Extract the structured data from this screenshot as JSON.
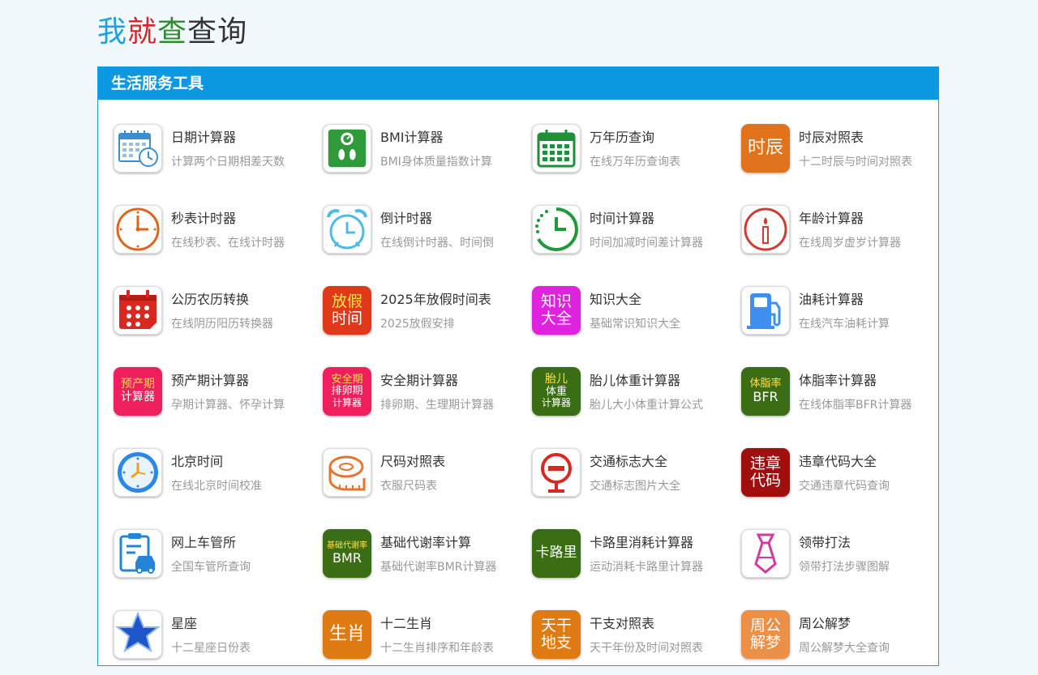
{
  "logo": {
    "c1": "我",
    "c2": "就",
    "c3": "查",
    "c4": "查",
    "c5": "询"
  },
  "panel": {
    "title": "生活服务工具"
  },
  "rows": [
    [
      {
        "title": "日期计算器",
        "sub": "计算两个日期相差天数",
        "icon": "calendar-clock-icon"
      },
      {
        "title": "BMI计算器",
        "sub": "BMI身体质量指数计算",
        "icon": "scale-icon"
      },
      {
        "title": "万年历查询",
        "sub": "在线万年历查询表",
        "icon": "calendar-icon"
      },
      {
        "title": "时辰对照表",
        "sub": "十二时辰与时间对照表",
        "icon": "text-icon",
        "text": [
          "时辰"
        ]
      }
    ],
    [
      {
        "title": "秒表计时器",
        "sub": "在线秒表、在线计时器",
        "icon": "clock-icon"
      },
      {
        "title": "倒计时器",
        "sub": "在线倒计时器、时间倒",
        "icon": "alarm-clock-icon"
      },
      {
        "title": "时间计算器",
        "sub": "时间加减时间差计算器",
        "icon": "time-circle-icon"
      },
      {
        "title": "年龄计算器",
        "sub": "在线周岁虚岁计算器",
        "icon": "candle-icon"
      }
    ],
    [
      {
        "title": "公历农历转换",
        "sub": "在线阴历阳历转换器",
        "icon": "red-calendar-icon"
      },
      {
        "title": "2025年放假时间表",
        "sub": "2025放假安排",
        "icon": "text-icon",
        "text": [
          "放假",
          "时间"
        ]
      },
      {
        "title": "知识大全",
        "sub": "基础常识知识大全",
        "icon": "text-icon",
        "text": [
          "知识",
          "大全"
        ]
      },
      {
        "title": "油耗计算器",
        "sub": "在线汽车油耗计算",
        "icon": "fuel-pump-icon"
      }
    ],
    [
      {
        "title": "预产期计算器",
        "sub": "孕期计算器、怀孕计算",
        "icon": "text-icon",
        "text": [
          "预产期",
          "计算器"
        ]
      },
      {
        "title": "安全期计算器",
        "sub": "排卵期、生理期计算器",
        "icon": "text-icon",
        "text": [
          "安全期",
          "排卵期",
          "计算器"
        ]
      },
      {
        "title": "胎儿体重计算器",
        "sub": "胎儿大小体重计算公式",
        "icon": "text-icon",
        "text": [
          "胎儿",
          "体重",
          "计算器"
        ]
      },
      {
        "title": "体脂率计算器",
        "sub": "在线体脂率BFR计算器",
        "icon": "text-icon",
        "text": [
          "体脂率",
          "BFR"
        ]
      }
    ],
    [
      {
        "title": "北京时间",
        "sub": "在线北京时间校准",
        "icon": "blue-clock-icon"
      },
      {
        "title": "尺码对照表",
        "sub": "衣服尺码表",
        "icon": "tape-measure-icon"
      },
      {
        "title": "交通标志大全",
        "sub": "交通标志图片大全",
        "icon": "traffic-sign-icon"
      },
      {
        "title": "违章代码大全",
        "sub": "交通违章代码查询",
        "icon": "text-icon",
        "text": [
          "违章",
          "代码"
        ]
      }
    ],
    [
      {
        "title": "网上车管所",
        "sub": "全国车管所查询",
        "icon": "car-form-icon"
      },
      {
        "title": "基础代谢率计算",
        "sub": "基础代谢率BMR计算器",
        "icon": "text-icon",
        "text": [
          "基础代谢率",
          "BMR"
        ]
      },
      {
        "title": "卡路里消耗计算器",
        "sub": "运动消耗卡路里计算器",
        "icon": "text-icon",
        "text": [
          "卡路里"
        ]
      },
      {
        "title": "领带打法",
        "sub": "领带打法步骤图解",
        "icon": "necktie-icon"
      }
    ],
    [
      {
        "title": "星座",
        "sub": "十二星座日份表",
        "icon": "star-icon"
      },
      {
        "title": "十二生肖",
        "sub": "十二生肖排序和年龄表",
        "icon": "text-icon",
        "text": [
          "生肖"
        ]
      },
      {
        "title": "干支对照表",
        "sub": "天干年份及时间对照表",
        "icon": "text-icon",
        "text": [
          "天干",
          "地支"
        ]
      },
      {
        "title": "周公解梦",
        "sub": "周公解梦大全查询",
        "icon": "text-icon",
        "text": [
          "周公",
          "解梦"
        ]
      }
    ]
  ],
  "colors": {
    "accent": "#0d98e2",
    "logo1": "#1da1e0",
    "logo2": "#d7262b",
    "logo3": "#3a8f32",
    "logo4": "#333333"
  }
}
